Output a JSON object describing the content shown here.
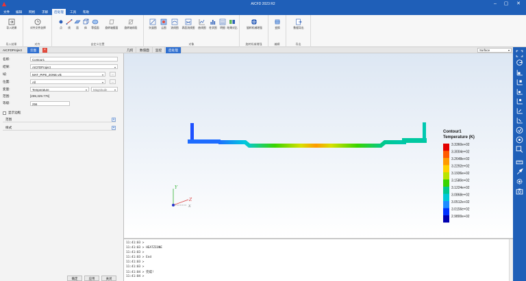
{
  "window": {
    "title": "AICFD 2023 R2"
  },
  "menu": [
    "文件",
    "编辑",
    "网格",
    "求解",
    "后处理",
    "工具",
    "帮助"
  ],
  "ribbon": {
    "groups": [
      {
        "label": "导入结果",
        "buttons": [
          "导入结果"
        ]
      },
      {
        "label": "对齐",
        "buttons": [
          "对齐文件选择"
        ]
      },
      {
        "label": "自定义位置",
        "buttons": [
          "点",
          "线",
          "面",
          "体",
          "等值面",
          "旋转轴截面",
          "旋转轴线段"
        ]
      },
      {
        "label": "对象",
        "buttons": [
          "矢量图",
          "云图",
          "流线图",
          "表面流线图",
          "曲线图",
          "柱状图",
          "明细",
          "结果对比"
        ]
      },
      {
        "label": "旋转机械增强",
        "buttons": [
          "旋转机械增强"
        ]
      },
      {
        "label": "编辑",
        "buttons": [
          "变换"
        ]
      },
      {
        "label": "导出",
        "buttons": [
          "数据导出"
        ]
      }
    ]
  },
  "left_panel": {
    "tabs": [
      "AICFDProject",
      "云图"
    ],
    "fields": {
      "name_label": "名称:",
      "name_value": "Contour1",
      "result_label": "结果:",
      "result_value": "AICFDProject",
      "domain_label": "域:",
      "domain_value": "MAT_PIPE_ZONE.vtk",
      "location_label": "位置:",
      "location_value": "All",
      "variable_label": "变量:",
      "variable_value": "Temperature",
      "component_value": "Magnitude",
      "range_label": "范围:",
      "range_value": "[299,329.776]",
      "levels_label": "等级:",
      "levels_value": "256"
    },
    "show_contour_label": "显示边框",
    "sections": [
      "范围",
      "样式"
    ],
    "buttons": [
      "确定",
      "应用",
      "关闭"
    ],
    "small_button": "..."
  },
  "view_tabs": [
    "几何",
    "数值面",
    "监控",
    "后处理"
  ],
  "surface_select": "Surface",
  "legend": {
    "title": "Contour1",
    "subtitle": "Temperature (K)",
    "values": [
      "3.3360e+02",
      "3.3004e+02",
      "3.2648e+02",
      "3.2292e+02",
      "3.1936e+02",
      "3.1580e+02",
      "3.1224e+02",
      "3.0868e+02",
      "3.0512e+02",
      "3.0156e+02",
      "2.9800e+02"
    ],
    "colors": [
      "#e30000",
      "#ff5a00",
      "#ff9a00",
      "#ffd200",
      "#b9e400",
      "#38d400",
      "#00c890",
      "#00c8d8",
      "#1e8cff",
      "#0032ff",
      "#0000b0"
    ]
  },
  "axes": {
    "x": "X",
    "y": "Y",
    "z": "Z"
  },
  "console": [
    "11:41:03 >",
    "11:41:03 > HEATZIONE",
    "11:41:03 >",
    "11:41:03 > End",
    "11:41:03 >",
    "11:41:03 >",
    "11:41:04 > 完成!",
    "11:41:04 >"
  ]
}
